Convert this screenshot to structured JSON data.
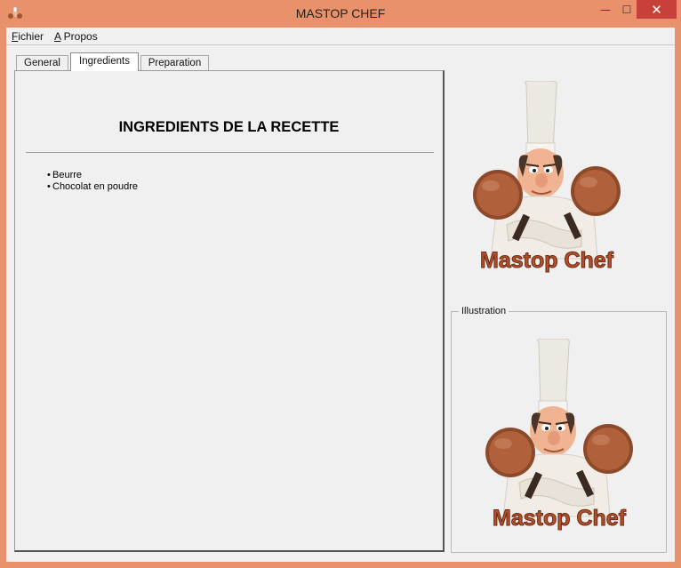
{
  "window": {
    "title": "MASTOP CHEF",
    "controls": {
      "minimize": "—",
      "maximize": "☐",
      "close": "✕"
    }
  },
  "menu": {
    "items": [
      {
        "mnemonic": "F",
        "rest": "ichier"
      },
      {
        "mnemonic": "A",
        "rest": " Propos"
      }
    ]
  },
  "tabs": [
    {
      "label": "General",
      "active": false
    },
    {
      "label": "Ingredients",
      "active": true
    },
    {
      "label": "Preparation",
      "active": false
    }
  ],
  "ingredients": {
    "heading": "INGREDIENTS DE LA RECETTE",
    "items": [
      "Beurre",
      "Chocolat en poudre"
    ]
  },
  "logo": {
    "text": "Mastop Chef",
    "icon": "chef-logo"
  },
  "illustration": {
    "legend": "Illustration",
    "text": "Mastop Chef",
    "icon": "chef-illustration"
  },
  "colors": {
    "frame": "#e8916a",
    "close": "#c7413a",
    "logo_text": "#b4502c"
  }
}
